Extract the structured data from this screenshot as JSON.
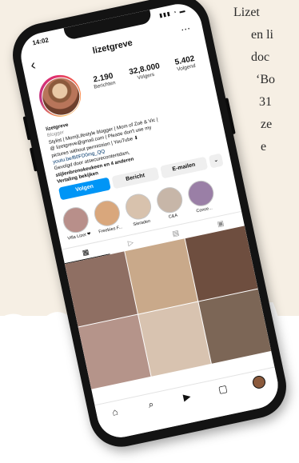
{
  "side_text": {
    "lines": [
      "Lizet",
      "en li",
      "doc",
      "‘Bo",
      "31",
      "ze",
      "e"
    ]
  },
  "status_bar": {
    "time": "14:02",
    "indicators": "▮▮▮ ◔ ▬"
  },
  "header": {
    "username": "lizetgreve",
    "back_icon": "chevron-left-icon",
    "more_icon": "more-icon"
  },
  "profile": {
    "stats": [
      {
        "value": "2.190",
        "label": "Berichten"
      },
      {
        "value": "32,8.000",
        "label": "Volgers"
      },
      {
        "value": "5.402",
        "label": "Volgend"
      }
    ],
    "name": "lizetgreve",
    "category": "Blogger",
    "bio_lines": [
      "Stylist | Mom|Lifestyle blogger | Mom of Zoë & Vic |",
      "@ lizetgreve@gmail.com | Please don't use my",
      "pictures without permission | YouTube ⬇"
    ],
    "link": "youtu.be/B0FD0mg_QQ",
    "followed_by_1": "Gevolgd door atsecurecontentdam,",
    "followed_by_2": "stijlenbrenokeukeen en 4 anderen",
    "translation": "Vertaling bekijken"
  },
  "actions": {
    "follow": "Volgen",
    "message": "Bericht",
    "email": "E-mailen",
    "more": "⌄"
  },
  "highlights": [
    {
      "label": "Villa Lizet ❤"
    },
    {
      "label": "Freebies F..."
    },
    {
      "label": "Sieraden"
    },
    {
      "label": "C&A"
    },
    {
      "label": "Conce..."
    }
  ],
  "grid_tabs": [
    {
      "icon": "grid-icon",
      "glyph": "▦"
    },
    {
      "icon": "reels-icon",
      "glyph": "▷"
    },
    {
      "icon": "guide-icon",
      "glyph": "▤"
    },
    {
      "icon": "tagged-icon",
      "glyph": "▣"
    }
  ],
  "tab_bar": [
    {
      "icon": "home-icon",
      "glyph": "⌂"
    },
    {
      "icon": "search-icon",
      "glyph": "⌕"
    },
    {
      "icon": "reels-icon",
      "glyph": "▶"
    },
    {
      "icon": "shop-icon",
      "glyph": "▢"
    }
  ],
  "colors": {
    "follow_button": "#0095f6",
    "background": "#f6efe4"
  }
}
